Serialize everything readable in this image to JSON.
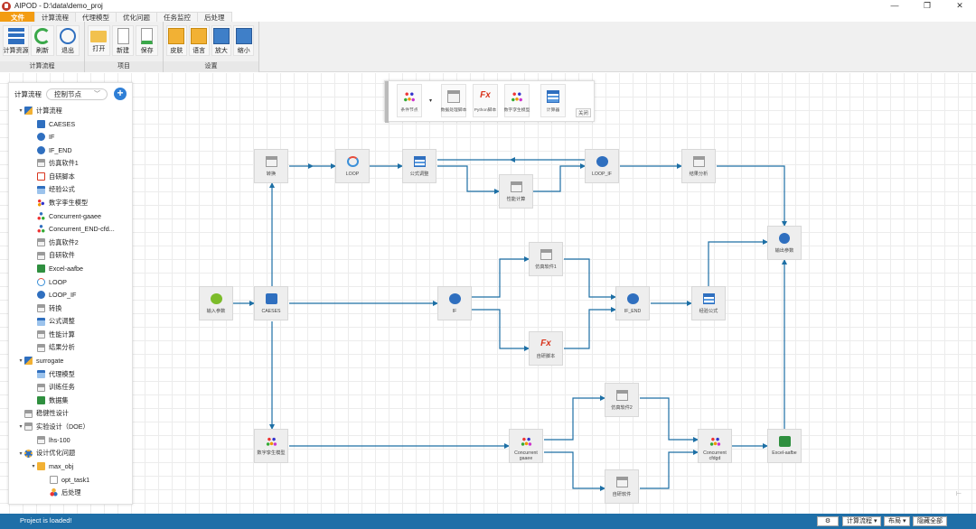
{
  "window": {
    "title": "AIPOD - D:\\data\\demo_proj",
    "min": "—",
    "max": "❐",
    "close": "✕"
  },
  "menu": [
    "文件",
    "计算流程",
    "代理模型",
    "优化问题",
    "任务监控",
    "后处理"
  ],
  "ribbon": {
    "groups": [
      {
        "name": "计算流程",
        "buttons": [
          "计算资源",
          "刷新",
          "退出"
        ]
      },
      {
        "name": "项目",
        "buttons": [
          "打开",
          "新建",
          "保存"
        ]
      },
      {
        "name": "设置",
        "buttons": [
          "皮肤",
          "语言",
          "放大",
          "缩小"
        ]
      }
    ]
  },
  "sidebar": {
    "title": "计算流程",
    "select": "控制节点",
    "add": "+",
    "tree": [
      {
        "label": "计算流程",
        "level": 0,
        "toggle": "▾",
        "icon": "group"
      },
      {
        "label": "CAESES",
        "level": 1,
        "icon": "blue-square"
      },
      {
        "label": "IF",
        "level": 1,
        "icon": "blue-circle"
      },
      {
        "label": "IF_END",
        "level": 1,
        "icon": "blue-circle"
      },
      {
        "label": "仿真软件1",
        "level": 1,
        "icon": "gray-window"
      },
      {
        "label": "自研脚本",
        "level": 1,
        "icon": "fx"
      },
      {
        "label": "经验公式",
        "level": 1,
        "icon": "formula"
      },
      {
        "label": "数字孪生模型",
        "level": 1,
        "icon": "dots"
      },
      {
        "label": "Concurrent-gaaee",
        "level": 1,
        "icon": "fork"
      },
      {
        "label": "Concurrent_END-cfd...",
        "level": 1,
        "icon": "fork"
      },
      {
        "label": "仿真软件2",
        "level": 1,
        "icon": "gray-window"
      },
      {
        "label": "自研软件",
        "level": 1,
        "icon": "gray-window"
      },
      {
        "label": "Excel-aafbe",
        "level": 1,
        "icon": "excel"
      },
      {
        "label": "LOOP",
        "level": 1,
        "icon": "loop"
      },
      {
        "label": "LOOP_IF",
        "level": 1,
        "icon": "blue-circle"
      },
      {
        "label": "转换",
        "level": 1,
        "icon": "gray-window"
      },
      {
        "label": "公式调整",
        "level": 1,
        "icon": "formula"
      },
      {
        "label": "性能计算",
        "level": 1,
        "icon": "gray-window"
      },
      {
        "label": "结果分析",
        "level": 1,
        "icon": "gray-window"
      },
      {
        "label": "surrogate",
        "level": 0,
        "toggle": "▾",
        "icon": "group"
      },
      {
        "label": "代理模型",
        "level": 1,
        "icon": "formula"
      },
      {
        "label": "训练任务",
        "level": 1,
        "icon": "gray-window"
      },
      {
        "label": "数据集",
        "level": 1,
        "icon": "excel"
      },
      {
        "label": "稳健性设计",
        "level": 0,
        "icon": "gray-window"
      },
      {
        "label": "实验设计（DOE）",
        "level": 0,
        "toggle": "▾",
        "icon": "gray-window"
      },
      {
        "label": "lhs-100",
        "level": 1,
        "icon": "gray-window"
      },
      {
        "label": "设计优化问题",
        "level": 0,
        "toggle": "▾",
        "icon": "gear"
      },
      {
        "label": "max_obj",
        "level": 1,
        "toggle": "▾",
        "icon": "folder"
      },
      {
        "label": "opt_task1",
        "level": 2,
        "icon": "doc"
      },
      {
        "label": "后处理",
        "level": 2,
        "icon": "shapes"
      }
    ]
  },
  "toolbox": {
    "buttons": [
      "条件节点",
      "数据处理脚本",
      "Python脚本",
      "数字孪生模型",
      "计算器"
    ],
    "dropdown": "▾",
    "close": "关闭"
  },
  "nodes": {
    "convert": "转换",
    "loop": "LOOP",
    "formula_adjust": "公式调整",
    "perf_calc": "性能计算",
    "loop_if": "LOOP_IF",
    "result_analysis": "结果分析",
    "output_param": "输出参数",
    "sim1": "仿真软件1",
    "input_param": "输入参数",
    "caeses": "CAESES",
    "if": "IF",
    "if_end": "IF_END",
    "exp_formula": "经验公式",
    "script": "自研脚本",
    "sim2": "仿真软件2",
    "twin": "数字孪生模型",
    "conc_gaaee": "Concurrent gaaee",
    "conc_cfdgd": "Concurrent cfdgd",
    "excel": "Excel-aafbe",
    "own_soft": "自研软件"
  },
  "colors": {
    "edge": "#1d6fa5",
    "accent": "#f39c12",
    "status": "#1f6fa8"
  },
  "statusbar": {
    "message": "Project is loaded!",
    "settings": "⚙",
    "flow": "计算流程 ▾",
    "layout": "布局 ▾",
    "hide_all": "隐藏全部"
  },
  "canvas_corner": "⊢"
}
